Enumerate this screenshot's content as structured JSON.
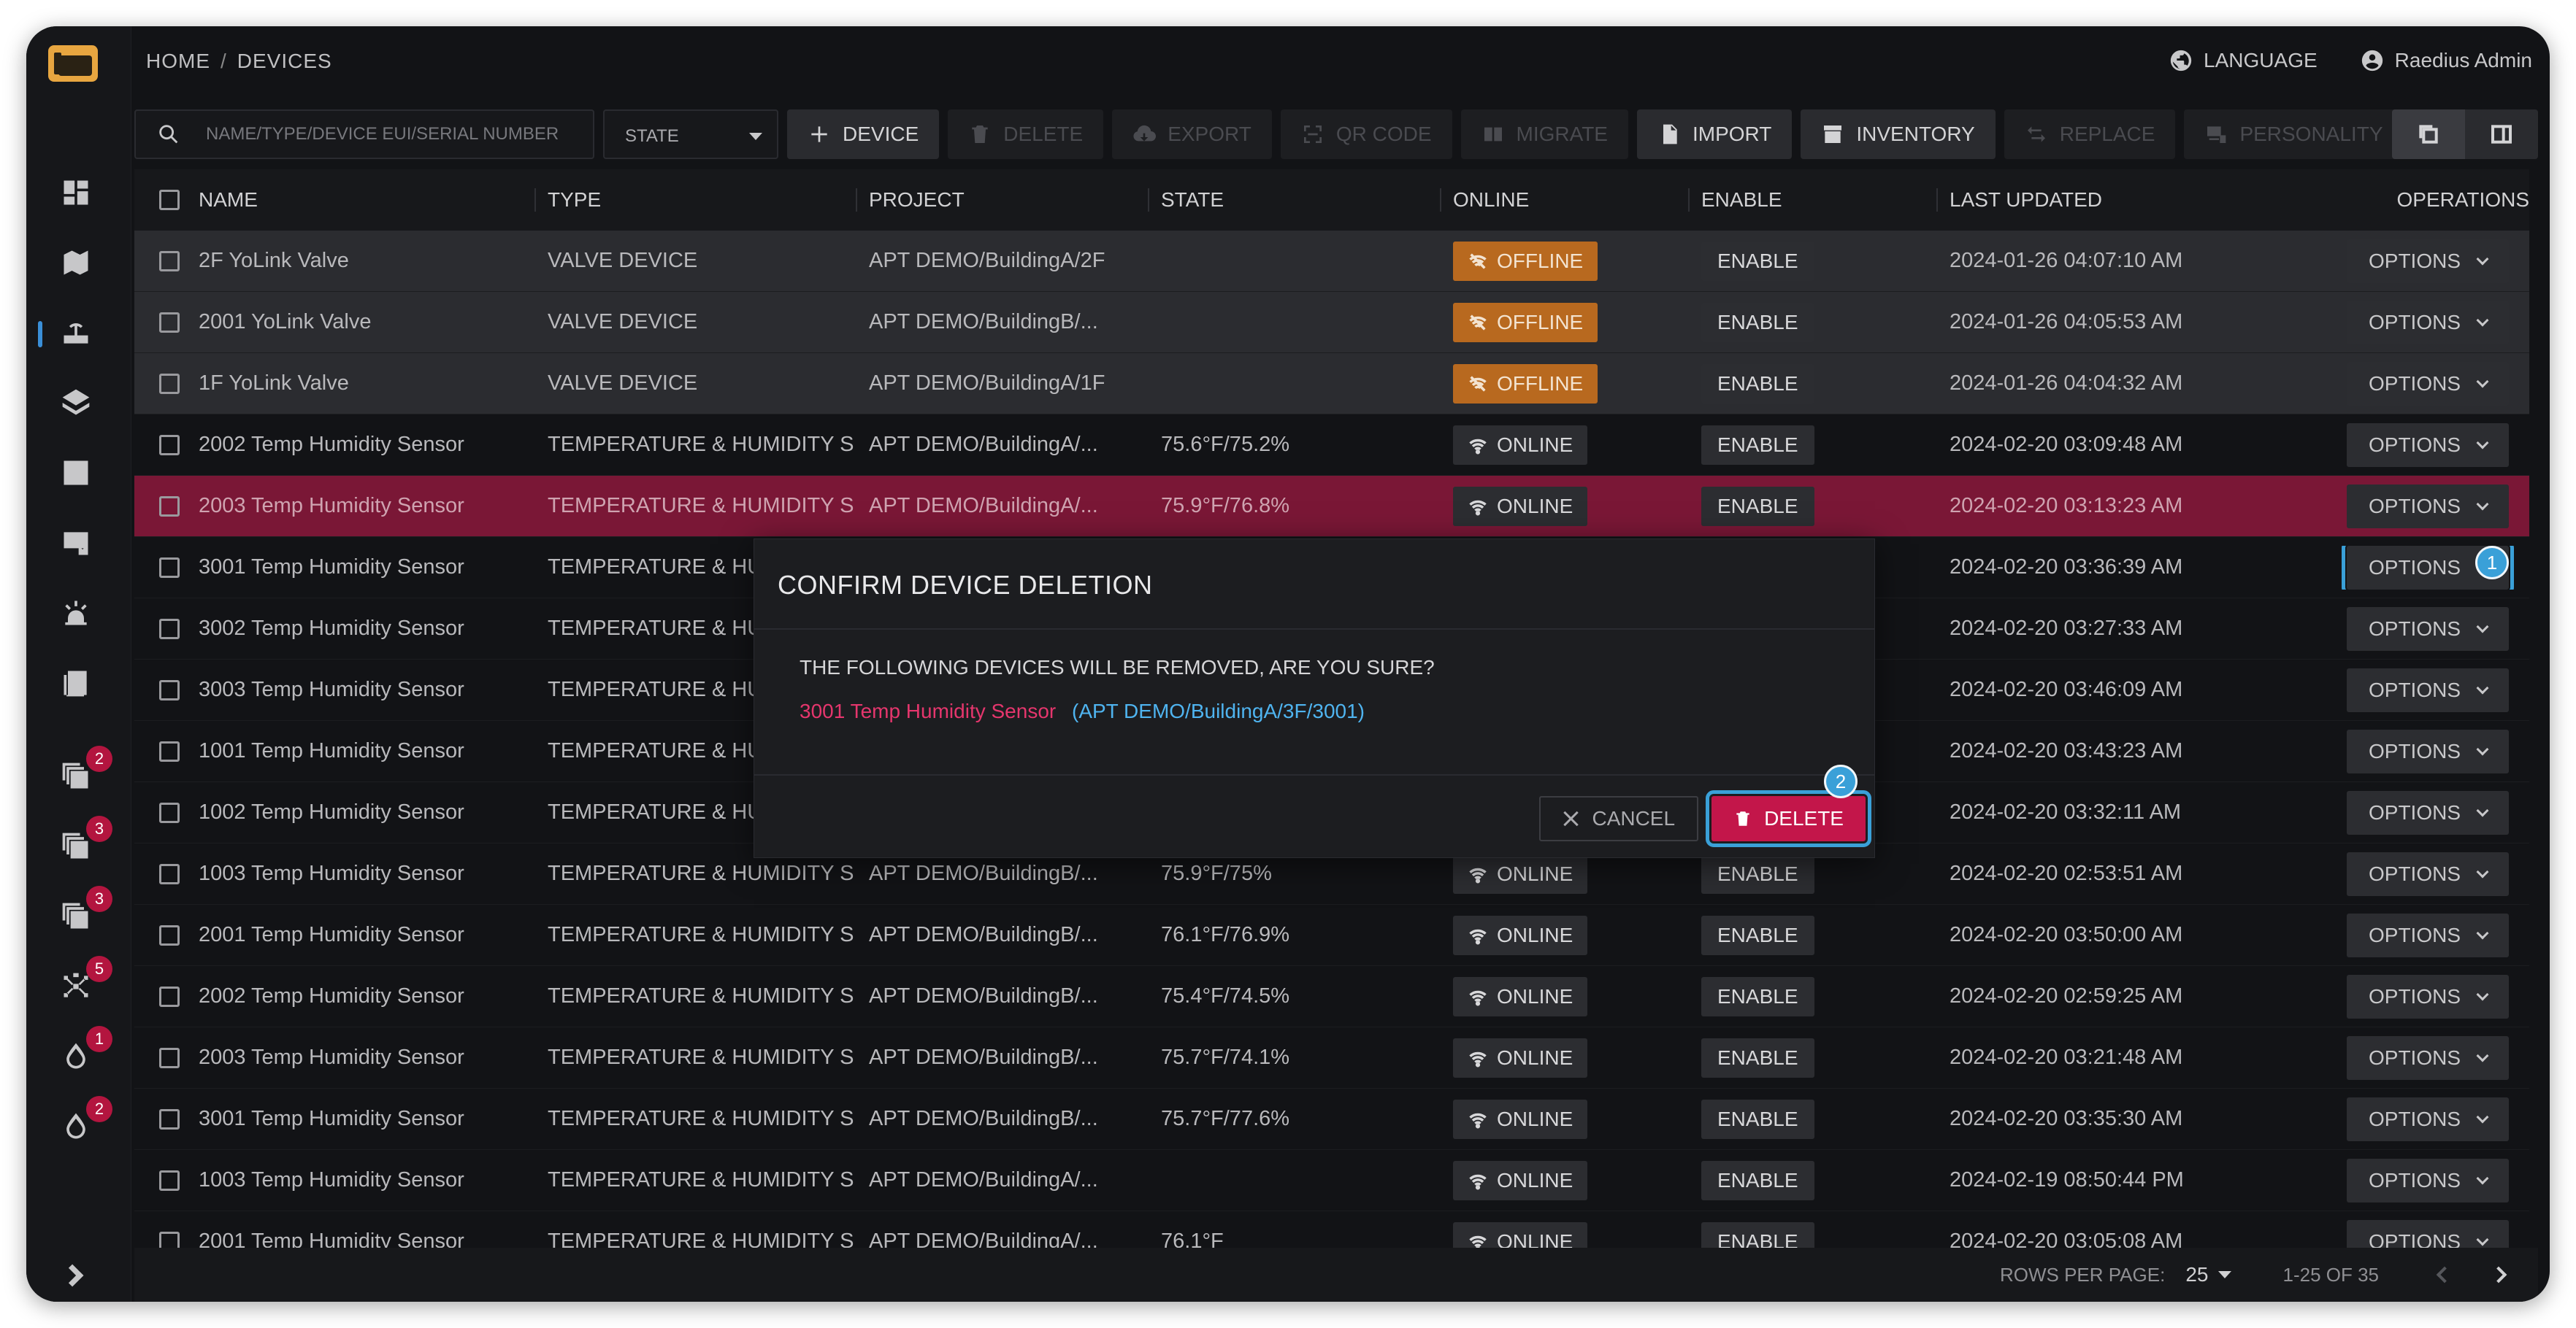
{
  "breadcrumb": {
    "home": "HOME",
    "sep": "/",
    "current": "DEVICES"
  },
  "header": {
    "language": "LANGUAGE",
    "user": "Raedius Admin"
  },
  "search": {
    "placeholder": "NAME/TYPE/DEVICE EUI/SERIAL NUMBER"
  },
  "state_select": {
    "label": "STATE"
  },
  "toolbar": {
    "device": "DEVICE",
    "delete": "DELETE",
    "export": "EXPORT",
    "qr": "QR CODE",
    "migrate": "MIGRATE",
    "import": "IMPORT",
    "inventory": "INVENTORY",
    "replace": "REPLACE",
    "personality": "PERSONALITY"
  },
  "sidebar": {
    "badges": [
      "2",
      "3",
      "3",
      "5",
      "1",
      "2"
    ]
  },
  "table": {
    "headers": [
      "NAME",
      "TYPE",
      "PROJECT",
      "STATE",
      "ONLINE",
      "ENABLE",
      "LAST UPDATED",
      "OPERATIONS"
    ],
    "enable_label": "ENABLE",
    "options_label": "OPTIONS",
    "rows": [
      {
        "name": "2F YoLink Valve",
        "type": "VALVE DEVICE",
        "project": "APT DEMO/BuildingA/2F",
        "state": "",
        "online": "OFFLINE",
        "updated": "2024-01-26 04:07:10 AM"
      },
      {
        "name": "2001 YoLink Valve",
        "type": "VALVE DEVICE",
        "project": "APT DEMO/BuildingB/...",
        "state": "",
        "online": "OFFLINE",
        "updated": "2024-01-26 04:05:53 AM"
      },
      {
        "name": "1F YoLink Valve",
        "type": "VALVE DEVICE",
        "project": "APT DEMO/BuildingA/1F",
        "state": "",
        "online": "OFFLINE",
        "updated": "2024-01-26 04:04:32 AM"
      },
      {
        "name": "2002 Temp Humidity Sensor",
        "type": "TEMPERATURE & HUMIDITY S",
        "project": "APT DEMO/BuildingA/...",
        "state": "75.6°F/75.2%",
        "online": "ONLINE",
        "updated": "2024-02-20 03:09:48 AM"
      },
      {
        "name": "2003 Temp Humidity Sensor",
        "type": "TEMPERATURE & HUMIDITY S",
        "project": "APT DEMO/BuildingA/...",
        "state": "75.9°F/76.8%",
        "online": "ONLINE",
        "updated": "2024-02-20 03:13:23 AM"
      },
      {
        "name": "3001 Temp Humidity Sensor",
        "type": "TEMPERATURE & HU",
        "project": "",
        "state": "",
        "online": "",
        "updated": "2024-02-20 03:36:39 AM"
      },
      {
        "name": "3002 Temp Humidity Sensor",
        "type": "TEMPERATURE & HU",
        "project": "",
        "state": "",
        "online": "",
        "updated": "2024-02-20 03:27:33 AM"
      },
      {
        "name": "3003 Temp Humidity Sensor",
        "type": "TEMPERATURE & HU",
        "project": "",
        "state": "",
        "online": "",
        "updated": "2024-02-20 03:46:09 AM"
      },
      {
        "name": "1001 Temp Humidity Sensor",
        "type": "TEMPERATURE & HU",
        "project": "",
        "state": "",
        "online": "",
        "updated": "2024-02-20 03:43:23 AM"
      },
      {
        "name": "1002 Temp Humidity Sensor",
        "type": "TEMPERATURE & HU",
        "project": "",
        "state": "",
        "online": "",
        "updated": "2024-02-20 03:32:11 AM"
      },
      {
        "name": "1003 Temp Humidity Sensor",
        "type": "TEMPERATURE & HUMIDITY S",
        "project": "APT DEMO/BuildingB/...",
        "state": "75.9°F/75%",
        "online": "ONLINE",
        "updated": "2024-02-20 02:53:51 AM"
      },
      {
        "name": "2001 Temp Humidity Sensor",
        "type": "TEMPERATURE & HUMIDITY S",
        "project": "APT DEMO/BuildingB/...",
        "state": "76.1°F/76.9%",
        "online": "ONLINE",
        "updated": "2024-02-20 03:50:00 AM"
      },
      {
        "name": "2002 Temp Humidity Sensor",
        "type": "TEMPERATURE & HUMIDITY S",
        "project": "APT DEMO/BuildingB/...",
        "state": "75.4°F/74.5%",
        "online": "ONLINE",
        "updated": "2024-02-20 02:59:25 AM"
      },
      {
        "name": "2003 Temp Humidity Sensor",
        "type": "TEMPERATURE & HUMIDITY S",
        "project": "APT DEMO/BuildingB/...",
        "state": "75.7°F/74.1%",
        "online": "ONLINE",
        "updated": "2024-02-20 03:21:48 AM"
      },
      {
        "name": "3001 Temp Humidity Sensor",
        "type": "TEMPERATURE & HUMIDITY S",
        "project": "APT DEMO/BuildingB/...",
        "state": "75.7°F/77.6%",
        "online": "ONLINE",
        "updated": "2024-02-20 03:35:30 AM"
      },
      {
        "name": "1003 Temp Humidity Sensor",
        "type": "TEMPERATURE & HUMIDITY S",
        "project": "APT DEMO/BuildingA/...",
        "state": "",
        "online": "ONLINE",
        "updated": "2024-02-19 08:50:44 PM"
      },
      {
        "name": "2001 Temp Humidity Sensor",
        "type": "TEMPERATURE & HUMIDITY S",
        "project": "APT DEMO/BuildingA/...",
        "state": "76.1°F",
        "online": "ONLINE",
        "updated": "2024-02-20 03:05:08 AM"
      }
    ]
  },
  "footer": {
    "rows_per_page_label": "ROWS PER PAGE:",
    "rows_per_page": "25",
    "range": "1-25 OF 35"
  },
  "modal": {
    "title": "CONFIRM DEVICE DELETION",
    "question": "THE FOLLOWING DEVICES WILL BE REMOVED, ARE YOU SURE?",
    "device_name": "3001 Temp Humidity Sensor",
    "device_path": "(APT DEMO/BuildingA/3F/3001)",
    "cancel": "CANCEL",
    "delete": "DELETE"
  },
  "markers": [
    "1",
    "2"
  ],
  "colors": {
    "accent": "#3aa0d8",
    "danger": "#c3164a",
    "offline": "#b8691f",
    "selected_row": "#7a1736"
  }
}
